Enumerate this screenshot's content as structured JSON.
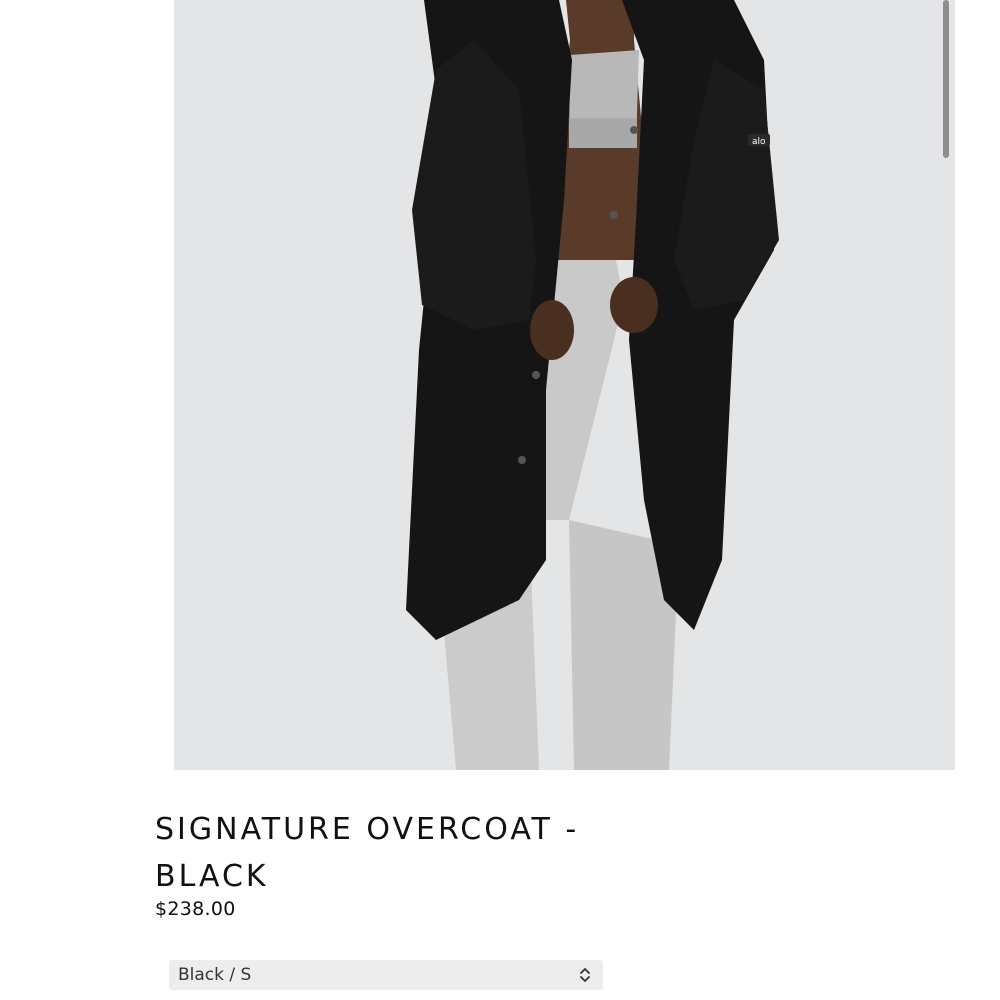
{
  "product": {
    "image_alt": "Model wearing black overcoat with grey sweatpants",
    "title": "SIGNATURE OVERCOAT - BLACK",
    "price": "$238.00"
  },
  "variant": {
    "selected": "Black / S",
    "icon": "chevron-up-down-icon"
  },
  "colors": {
    "image_background": "#e4e5e7",
    "coat": "#141414",
    "sweats": "#c8c8c8",
    "select_background": "#ededee"
  }
}
